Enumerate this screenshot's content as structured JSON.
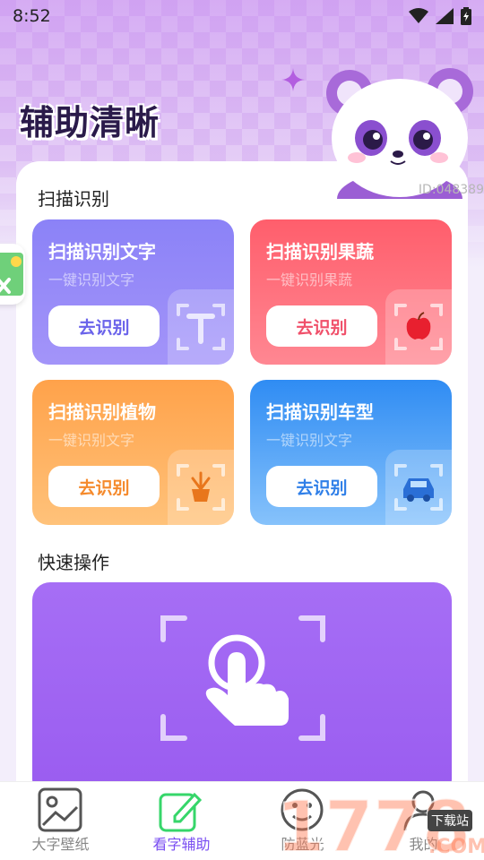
{
  "status_bar": {
    "time": "8:52",
    "icons": [
      "wifi-icon",
      "signal-icon",
      "battery-icon"
    ]
  },
  "header": {
    "title": "辅助清晰",
    "mascot": "panda-mascot"
  },
  "watermark_id": "ID:048389",
  "scan_section": {
    "title": "扫描识别",
    "cards": [
      {
        "title": "扫描识别文字",
        "subtitle": "一键识别文字",
        "button": "去识别",
        "icon": "text-t-icon",
        "color_from": "#8b82f7",
        "color_to": "#9e8ff8",
        "button_color": "#6a63ea"
      },
      {
        "title": "扫描识别果蔬",
        "subtitle": "一键识别果蔬",
        "button": "去识别",
        "icon": "apple-icon",
        "color_from": "#ff5e6c",
        "color_to": "#ff8792",
        "button_color": "#f0506a"
      },
      {
        "title": "扫描识别植物",
        "subtitle": "一键识别文字",
        "button": "去识别",
        "icon": "plant-icon",
        "color_from": "#ffa24a",
        "color_to": "#ffc27a",
        "button_color": "#f58a2c"
      },
      {
        "title": "扫描识别车型",
        "subtitle": "一键识别文字",
        "button": "去识别",
        "icon": "car-icon",
        "color_from": "#2f8cf3",
        "color_to": "#7cbcfb",
        "button_color": "#2f7fe8"
      }
    ]
  },
  "quick_section": {
    "title": "快速操作",
    "icon": "tap-gesture-icon",
    "color": "#9f62f2"
  },
  "tab_bar": {
    "items": [
      {
        "label": "大字壁纸",
        "icon": "wallpaper-icon",
        "active": false
      },
      {
        "label": "看字辅助",
        "icon": "edit-icon",
        "active": true
      },
      {
        "label": "防蓝光",
        "icon": "eye-care-icon",
        "active": false
      },
      {
        "label": "我的",
        "icon": "profile-icon",
        "active": false
      }
    ]
  },
  "site_watermark": {
    "logo": "1778.COM",
    "badge": "下载站"
  },
  "colors": {
    "accent": "#7a4ef2",
    "hero_background": "#dcbcf3"
  }
}
